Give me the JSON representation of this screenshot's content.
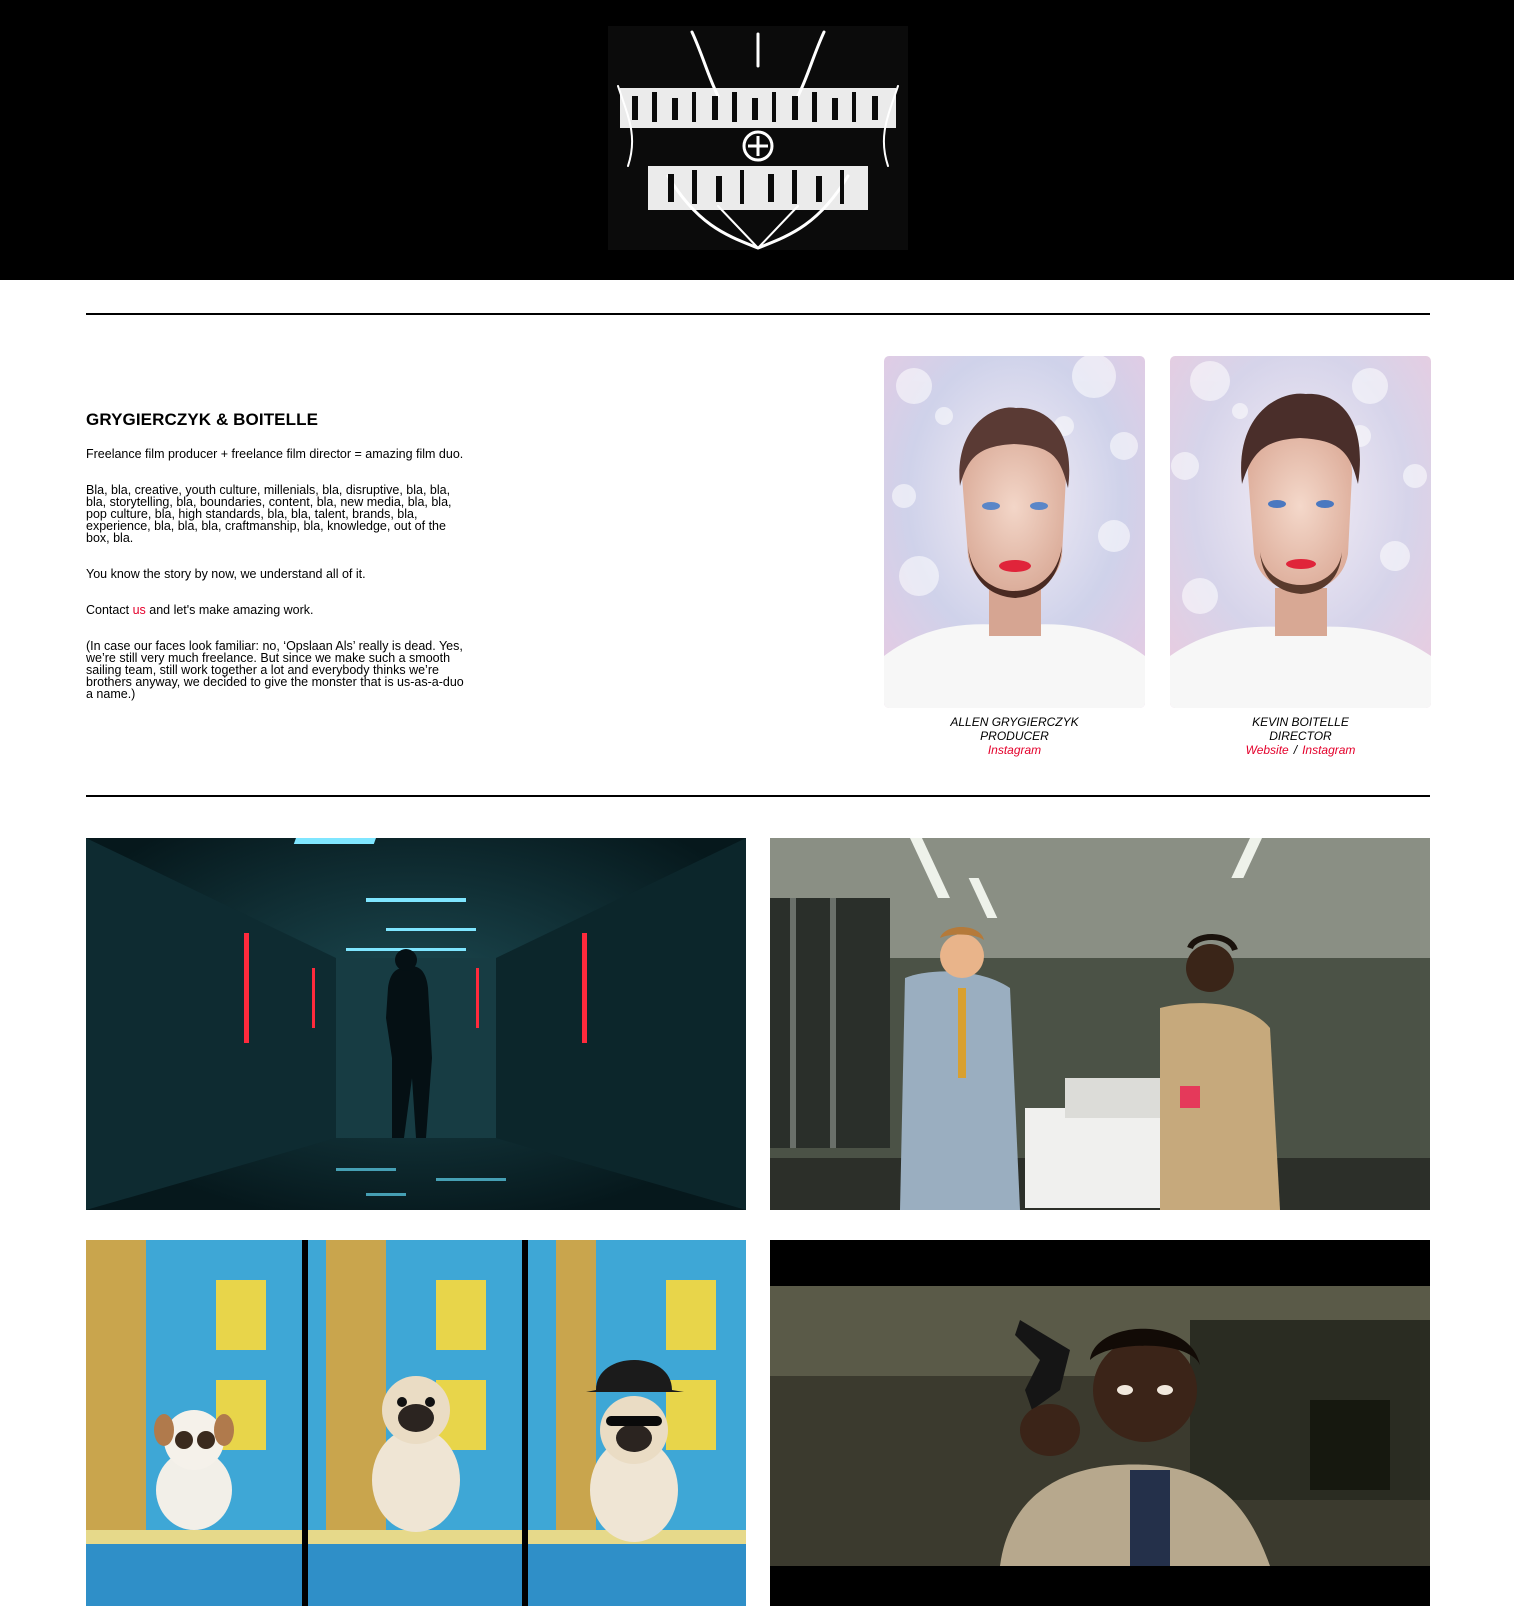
{
  "logo": {
    "alt_text": "GRYGIERCZYK & BOITELLE",
    "icon": "black-metal-logo"
  },
  "about": {
    "title": "GRYGIERCZYK & BOITELLE",
    "intro": "Freelance film producer + freelance film director = amazing film duo.",
    "buzzwords": "Bla, bla, creative, youth culture, millenials, bla, disruptive, bla, bla, bla, storytelling, bla, boundaries, content, bla, new media, bla, bla, pop culture, bla, high standards, bla, bla, talent, brands, bla, experience, bla, bla, bla, craftmanship, bla, knowledge, out of the box, bla.",
    "story": "You know the story by now, we understand all of it.",
    "contact_prefix": "Contact ",
    "contact_link": "us",
    "contact_suffix": " and let's make amazing work.",
    "note": "(In case our faces look familiar: no, ‘Opslaan Als’ really is dead. Yes, we’re still very much freelance. But since we make such a smooth sailing team, still work together a lot and everybody thinks we’re brothers anyway, we decided to give the monster that is us-as-a-duo a name.)"
  },
  "people": {
    "allen": {
      "name": "ALLEN GRYGIERCZYK",
      "role": "PRODUCER",
      "instagram": "Instagram"
    },
    "kevin": {
      "name": "KEVIN BOITELLE",
      "role": "DIRECTOR",
      "website": "Website",
      "separator": "/",
      "instagram": "Instagram"
    }
  },
  "work_tiles": [
    {
      "name": "neon-corridor-still"
    },
    {
      "name": "office-printer-still"
    },
    {
      "name": "pug-triptych-still"
    },
    {
      "name": "gunman-still"
    }
  ],
  "colors": {
    "accent": "#e4002b",
    "header_bg": "#000000",
    "page_bg": "#ffffff"
  }
}
